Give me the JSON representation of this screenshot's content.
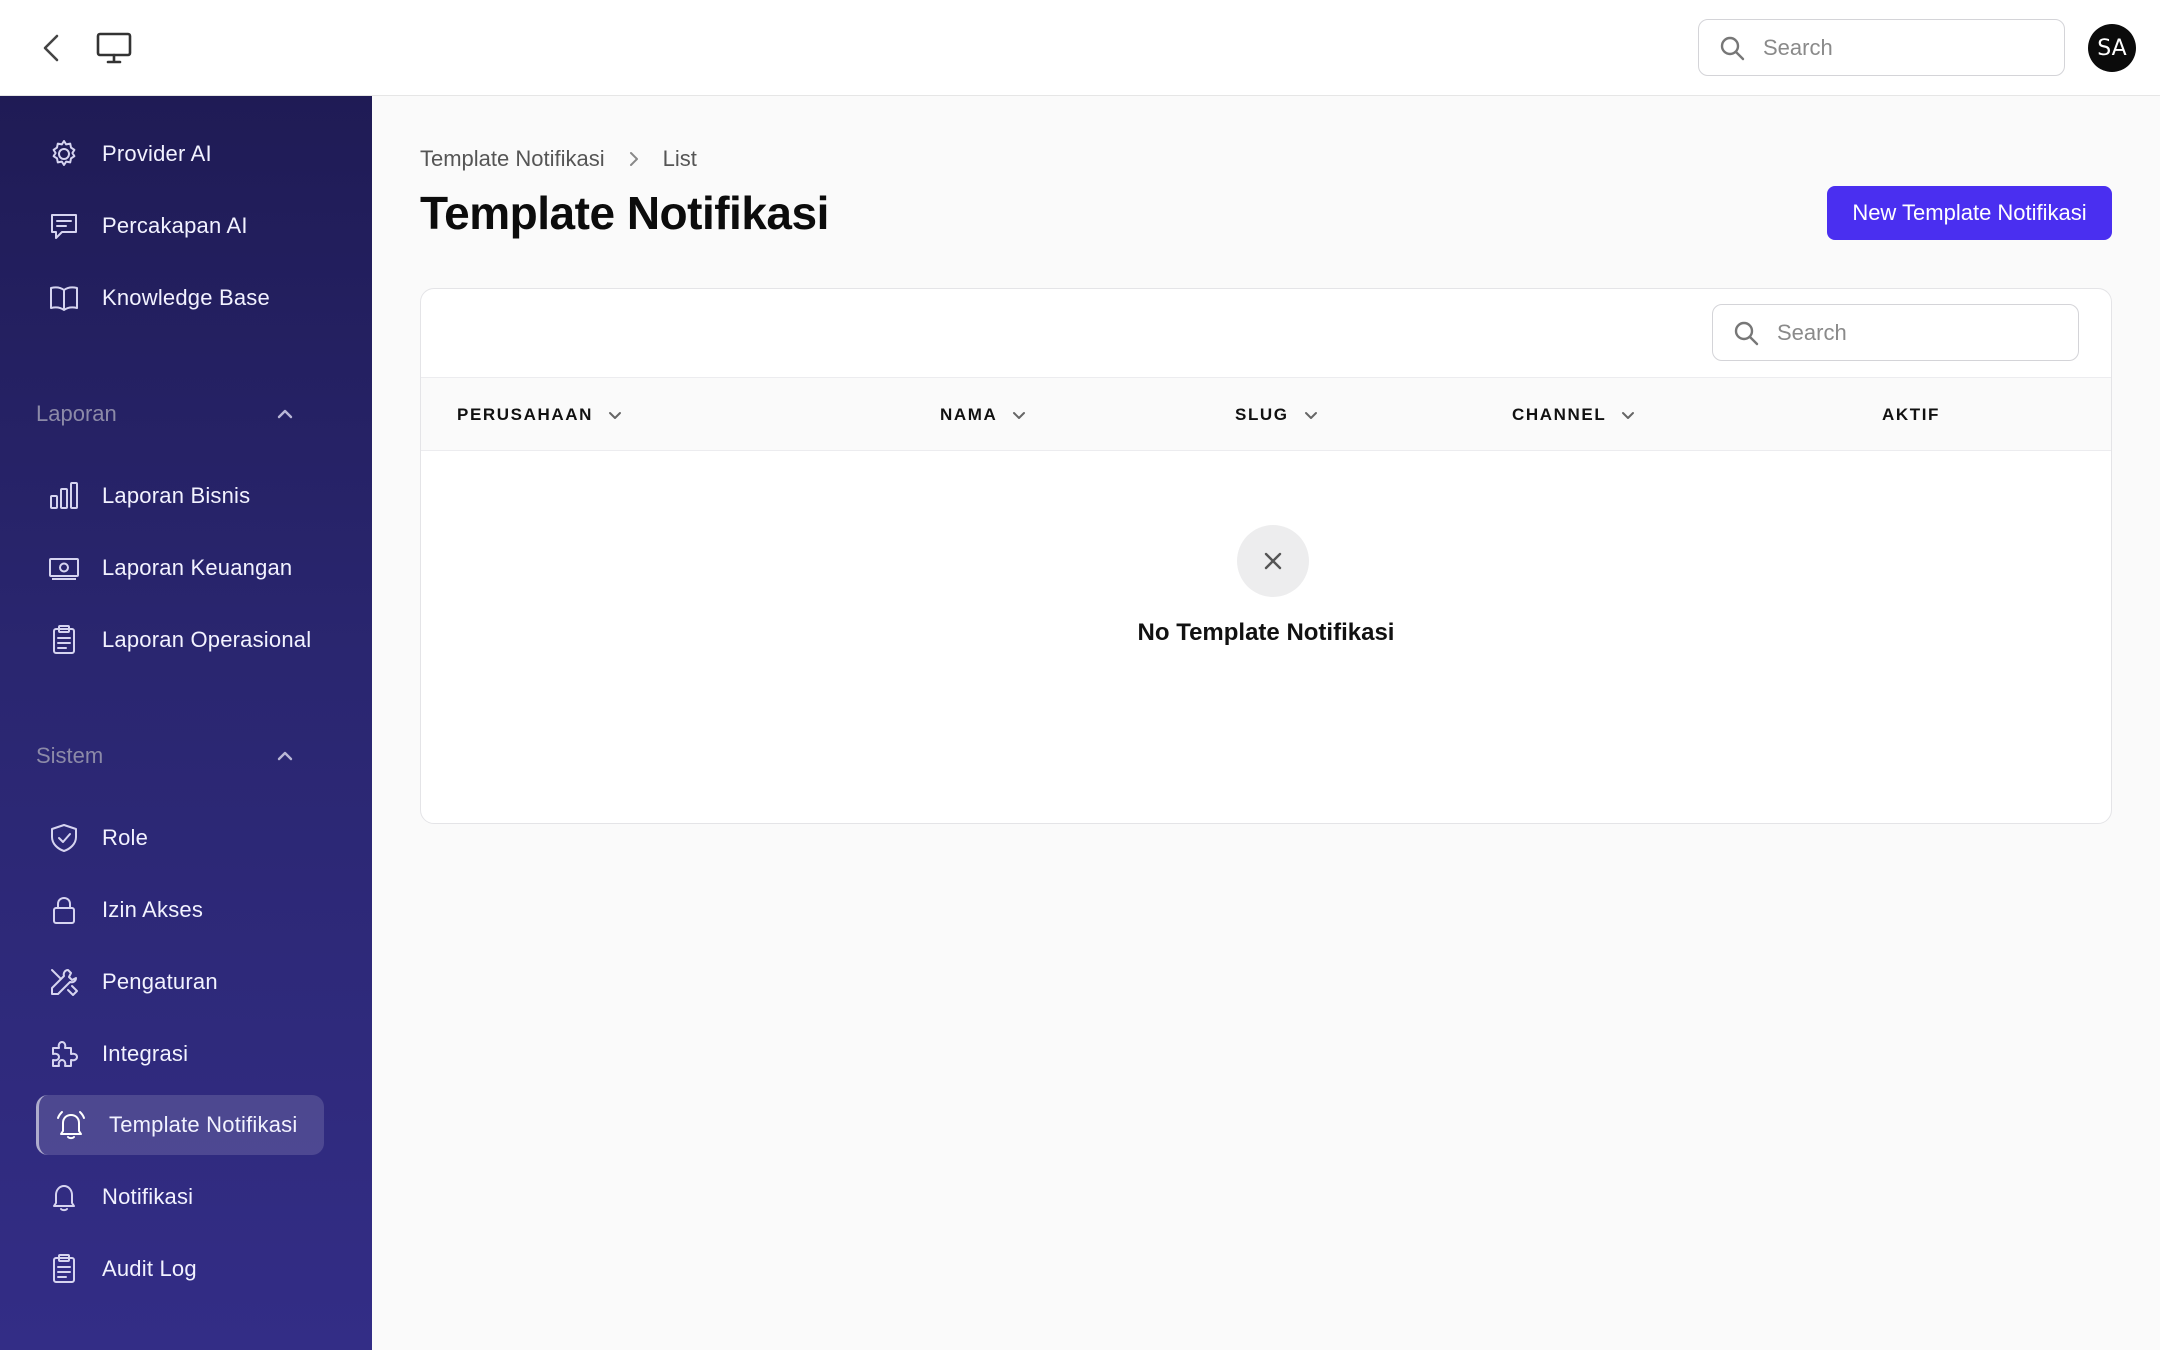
{
  "topbar": {
    "search_placeholder": "Search",
    "avatar_initials": "SA"
  },
  "sidebar": {
    "items_top": [
      {
        "label": "Provider AI",
        "icon": "gear-icon"
      },
      {
        "label": "Percakapan AI",
        "icon": "chat-icon"
      },
      {
        "label": "Knowledge Base",
        "icon": "book-icon"
      }
    ],
    "group_laporan": {
      "label": "Laporan",
      "items": [
        {
          "label": "Laporan Bisnis",
          "icon": "bar-chart-icon"
        },
        {
          "label": "Laporan Keuangan",
          "icon": "cash-icon"
        },
        {
          "label": "Laporan Operasional",
          "icon": "clipboard-icon"
        }
      ]
    },
    "group_sistem": {
      "label": "Sistem",
      "items": [
        {
          "label": "Role",
          "icon": "shield-check-icon"
        },
        {
          "label": "Izin Akses",
          "icon": "lock-icon"
        },
        {
          "label": "Pengaturan",
          "icon": "wrench-icon"
        },
        {
          "label": "Integrasi",
          "icon": "puzzle-icon"
        },
        {
          "label": "Template Notifikasi",
          "icon": "bell-alert-icon",
          "active": true
        },
        {
          "label": "Notifikasi",
          "icon": "bell-icon"
        },
        {
          "label": "Audit Log",
          "icon": "clipboard-icon"
        }
      ]
    }
  },
  "breadcrumb": {
    "parent": "Template Notifikasi",
    "current": "List"
  },
  "page": {
    "title": "Template Notifikasi",
    "new_button": "New Template Notifikasi"
  },
  "table": {
    "search_placeholder": "Search",
    "columns": [
      "PERUSAHAAN",
      "NAMA",
      "SLUG",
      "CHANNEL",
      "AKTIF"
    ],
    "rows": [],
    "empty_message": "No Template Notifikasi"
  },
  "colors": {
    "accent": "#4a2ff0",
    "sidebar_top": "#1f1b55",
    "sidebar_bottom": "#332d86"
  }
}
